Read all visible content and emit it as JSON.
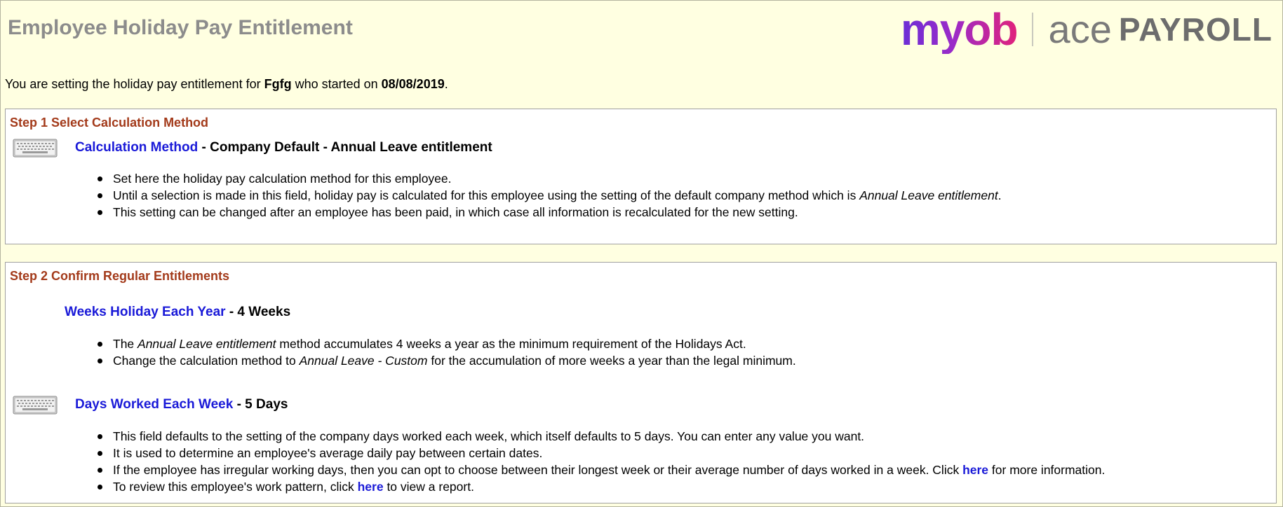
{
  "header": {
    "title": "Employee Holiday Pay Entitlement",
    "logo": {
      "myob": "myob",
      "ace": "ace",
      "payroll": "PAYROLL"
    }
  },
  "intro": {
    "prefix": "You are setting the holiday pay entitlement for ",
    "employee": "Fgfg",
    "middle": " who started on ",
    "start_date": "08/08/2019",
    "suffix": "."
  },
  "step1": {
    "heading": "Step 1 Select Calculation Method",
    "field": {
      "label": "Calculation Method",
      "value": " - Company Default - Annual Leave entitlement",
      "icon": "keyboard-icon"
    },
    "bullets": {
      "b1": "Set here the holiday pay calculation method for this employee.",
      "b2_pre": "Until a selection is made in this field, holiday pay is calculated for this employee using the setting of the default company method which is ",
      "b2_em": "Annual Leave entitlement",
      "b2_post": ".",
      "b3": "This setting can be changed after an employee has been paid, in which case all information is recalculated for the new setting."
    }
  },
  "step2": {
    "heading": "Step 2 Confirm Regular Entitlements",
    "weeks": {
      "label": "Weeks Holiday Each Year",
      "value": " - 4 Weeks",
      "b1_pre": "The ",
      "b1_em": "Annual Leave entitlement",
      "b1_post": " method accumulates 4 weeks a year as the minimum requirement of the Holidays Act.",
      "b2_pre": "Change the calculation method to ",
      "b2_em": "Annual Leave - Custom",
      "b2_post": " for the accumulation of more weeks a year than the legal minimum."
    },
    "days": {
      "label": "Days Worked Each Week",
      "value": " - 5 Days",
      "icon": "keyboard-icon",
      "b1": "This field defaults to the setting of the company days worked each week, which itself defaults to 5 days. You can enter any value you want.",
      "b2": "It is used to determine an employee's average daily pay between certain dates.",
      "b3_pre": "If the employee has irregular working days, then you can opt to choose between their longest week or their average number of days worked in a week. Click ",
      "b3_link": "here",
      "b3_post": " for more information.",
      "b4_pre": "To review this employee's work pattern, click ",
      "b4_link": "here",
      "b4_post": " to view a report."
    }
  },
  "colors": {
    "background": "#ffffe1",
    "link": "#1a1ad8",
    "step_heading": "#a33a1a",
    "title": "#8c8c8c"
  }
}
